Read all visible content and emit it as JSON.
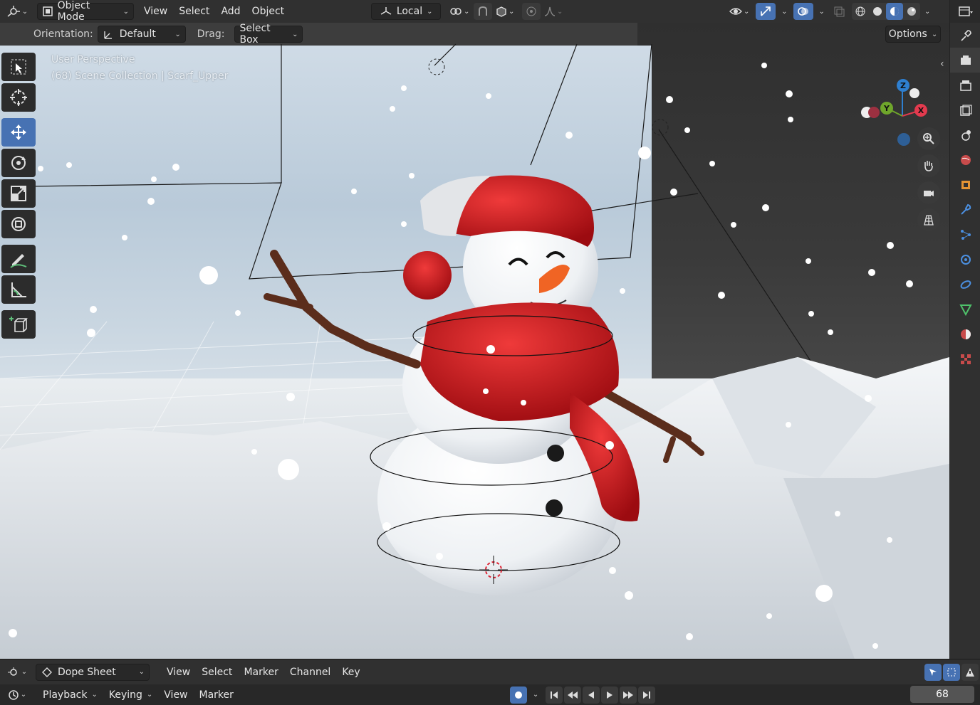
{
  "header": {
    "editor_type_icon": "view3d-editor-icon",
    "mode": "Object Mode",
    "menu": [
      "View",
      "Select",
      "Add",
      "Object"
    ],
    "transform_pivot": "Local",
    "options_label": "Options"
  },
  "tool_settings": {
    "orientation_label": "Orientation:",
    "orientation_value": "Default",
    "drag_label": "Drag:",
    "drag_value": "Select Box"
  },
  "viewport": {
    "view_name": "User Perspective",
    "collection_info": "(68) Scene Collection | Scarf_Upper"
  },
  "toolbar": {
    "tools": [
      "select-box",
      "cursor",
      "move",
      "rotate",
      "scale",
      "transform",
      "annotate",
      "measure",
      "add-cube"
    ],
    "active": "move"
  },
  "gizmo": {
    "axes": [
      "X",
      "Y",
      "Z"
    ],
    "colors": {
      "x": "#e33a4e",
      "y": "#6fa62b",
      "z": "#2e7fd0"
    }
  },
  "dopesheet": {
    "editor_name": "Dope Sheet",
    "menu": [
      "View",
      "Select",
      "Marker",
      "Channel",
      "Key"
    ]
  },
  "timeline": {
    "menu": [
      "Playback",
      "Keying",
      "View",
      "Marker"
    ],
    "current_frame": "68"
  },
  "colors": {
    "accent": "#4772b3",
    "header_bg": "#303030",
    "scarf_red": "#c8141a"
  }
}
